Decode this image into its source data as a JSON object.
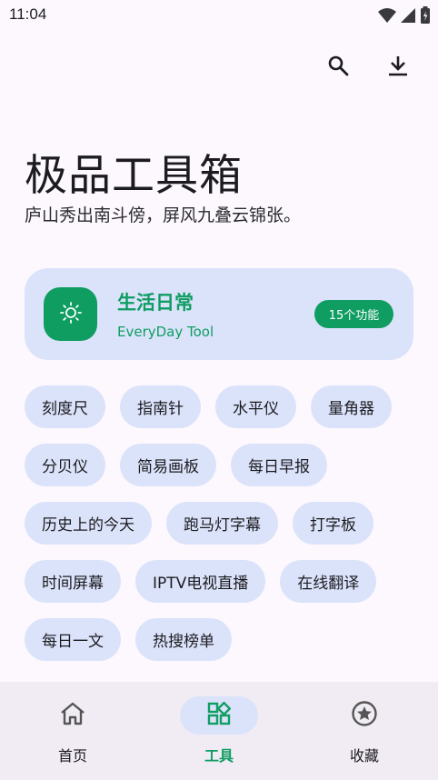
{
  "status_bar": {
    "time": "11:04"
  },
  "header": {
    "title": "极品工具箱",
    "subtitle": "庐山秀出南斗傍，屏风九叠云锦张。"
  },
  "feature_card": {
    "title": "生活日常",
    "subtitle": "EveryDay Tool",
    "badge": "15个功能"
  },
  "tools": [
    "刻度尺",
    "指南针",
    "水平仪",
    "量角器",
    "分贝仪",
    "简易画板",
    "每日早报",
    "历史上的今天",
    "跑马灯字幕",
    "打字板",
    "时间屏幕",
    "IPTV电视直播",
    "在线翻译",
    "每日一文",
    "热搜榜单"
  ],
  "bottom_nav": {
    "home": "首页",
    "tools": "工具",
    "favorites": "收藏"
  },
  "colors": {
    "accent": "#0f9d62",
    "chip_bg": "#dbe3fb",
    "background": "#fcf8fd",
    "nav_bg": "#f1ecf4"
  }
}
